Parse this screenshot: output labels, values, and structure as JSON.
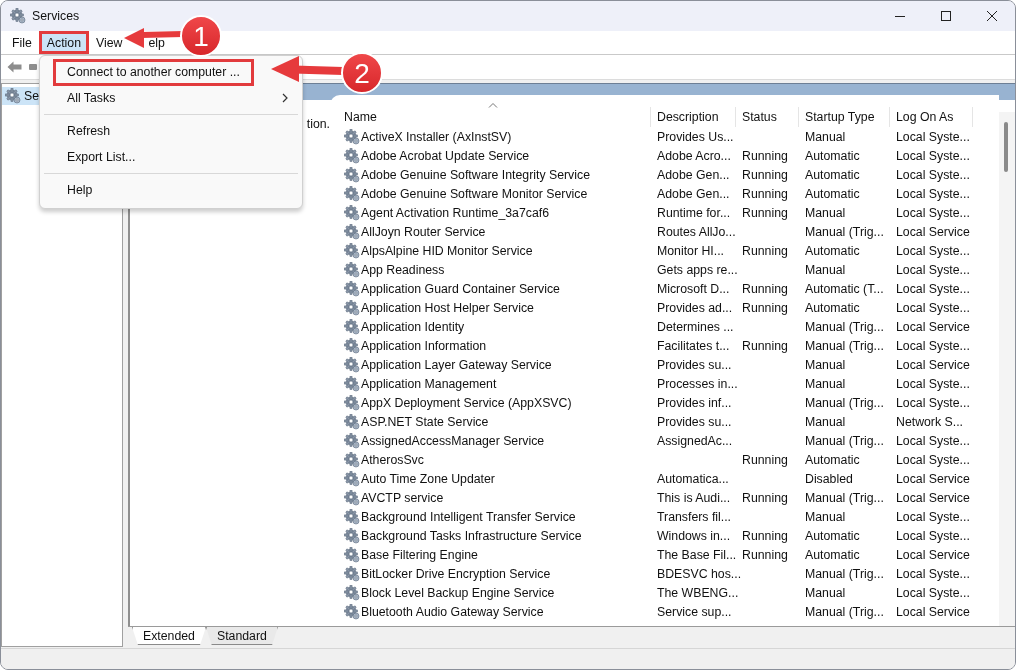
{
  "window": {
    "title": "Services"
  },
  "menu_bar": [
    {
      "label": "File",
      "selected": false,
      "outlined": false
    },
    {
      "label": "Action",
      "selected": true,
      "outlined": true
    },
    {
      "label": "View",
      "selected": false,
      "outlined": false
    },
    {
      "label": "elp",
      "selected": false,
      "outlined": false
    }
  ],
  "action_menu": [
    {
      "kind": "item",
      "label": "Connect to another computer ...",
      "outlined": true
    },
    {
      "kind": "submenu",
      "label": "All Tasks",
      "outlined": false
    },
    {
      "kind": "separator"
    },
    {
      "kind": "item",
      "label": "Refresh",
      "outlined": false
    },
    {
      "kind": "item",
      "label": "Export List...",
      "outlined": false
    },
    {
      "kind": "separator"
    },
    {
      "kind": "item",
      "label": "Help",
      "outlined": false
    }
  ],
  "tree": {
    "items": [
      {
        "label": "Se",
        "selected": true
      }
    ]
  },
  "description_pane": {
    "text": "tion."
  },
  "table": {
    "columns": [
      "Name",
      "Description",
      "Status",
      "Startup Type",
      "Log On As"
    ],
    "rows": [
      {
        "name": "ActiveX Installer (AxInstSV)",
        "description": "Provides Us...",
        "startup_type": "Manual",
        "log_on_as": "Local Syste..."
      },
      {
        "name": "Adobe Acrobat Update Service",
        "description": "Adobe Acro...",
        "status": "Running",
        "startup_type": "Automatic",
        "log_on_as": "Local Syste..."
      },
      {
        "name": "Adobe Genuine Software Integrity Service",
        "description": "Adobe Gen...",
        "status": "Running",
        "startup_type": "Automatic",
        "log_on_as": "Local Syste..."
      },
      {
        "name": "Adobe Genuine Software Monitor Service",
        "description": "Adobe Gen...",
        "status": "Running",
        "startup_type": "Automatic",
        "log_on_as": "Local Syste..."
      },
      {
        "name": "Agent Activation Runtime_3a7caf6",
        "description": "Runtime for...",
        "status": "Running",
        "startup_type": "Manual",
        "log_on_as": "Local Syste..."
      },
      {
        "name": "AllJoyn Router Service",
        "description": "Routes AllJo...",
        "startup_type": "Manual (Trig...",
        "log_on_as": "Local Service"
      },
      {
        "name": "AlpsAlpine HID Monitor Service",
        "description": "Monitor HI...",
        "status": "Running",
        "startup_type": "Automatic",
        "log_on_as": "Local Syste..."
      },
      {
        "name": "App Readiness",
        "description": "Gets apps re...",
        "startup_type": "Manual",
        "log_on_as": "Local Syste..."
      },
      {
        "name": "Application Guard Container Service",
        "description": "Microsoft D...",
        "status": "Running",
        "startup_type": "Automatic (T...",
        "log_on_as": "Local Syste..."
      },
      {
        "name": "Application Host Helper Service",
        "description": "Provides ad...",
        "status": "Running",
        "startup_type": "Automatic",
        "log_on_as": "Local Syste..."
      },
      {
        "name": "Application Identity",
        "description": "Determines ...",
        "startup_type": "Manual (Trig...",
        "log_on_as": "Local Service"
      },
      {
        "name": "Application Information",
        "description": "Facilitates t...",
        "status": "Running",
        "startup_type": "Manual (Trig...",
        "log_on_as": "Local Syste..."
      },
      {
        "name": "Application Layer Gateway Service",
        "description": "Provides su...",
        "startup_type": "Manual",
        "log_on_as": "Local Service"
      },
      {
        "name": "Application Management",
        "description": "Processes in...",
        "startup_type": "Manual",
        "log_on_as": "Local Syste..."
      },
      {
        "name": "AppX Deployment Service (AppXSVC)",
        "description": "Provides inf...",
        "startup_type": "Manual (Trig...",
        "log_on_as": "Local Syste..."
      },
      {
        "name": "ASP.NET State Service",
        "description": "Provides su...",
        "startup_type": "Manual",
        "log_on_as": "Network S..."
      },
      {
        "name": "AssignedAccessManager Service",
        "description": "AssignedAc...",
        "startup_type": "Manual (Trig...",
        "log_on_as": "Local Syste..."
      },
      {
        "name": "AtherosSvc",
        "status": "Running",
        "startup_type": "Automatic",
        "log_on_as": "Local Syste..."
      },
      {
        "name": "Auto Time Zone Updater",
        "description": "Automatica...",
        "startup_type": "Disabled",
        "log_on_as": "Local Service"
      },
      {
        "name": "AVCTP service",
        "description": "This is Audi...",
        "status": "Running",
        "startup_type": "Manual (Trig...",
        "log_on_as": "Local Service"
      },
      {
        "name": "Background Intelligent Transfer Service",
        "description": "Transfers fil...",
        "startup_type": "Manual",
        "log_on_as": "Local Syste..."
      },
      {
        "name": "Background Tasks Infrastructure Service",
        "description": "Windows in...",
        "status": "Running",
        "startup_type": "Automatic",
        "log_on_as": "Local Syste..."
      },
      {
        "name": "Base Filtering Engine",
        "description": "The Base Fil...",
        "status": "Running",
        "startup_type": "Automatic",
        "log_on_as": "Local Service"
      },
      {
        "name": "BitLocker Drive Encryption Service",
        "description": "BDESVC hos...",
        "startup_type": "Manual (Trig...",
        "log_on_as": "Local Syste..."
      },
      {
        "name": "Block Level Backup Engine Service",
        "description": "The WBENG...",
        "startup_type": "Manual",
        "log_on_as": "Local Syste..."
      },
      {
        "name": "Bluetooth Audio Gateway Service",
        "description": "Service sup...",
        "startup_type": "Manual (Trig...",
        "log_on_as": "Local Service"
      }
    ]
  },
  "view_tabs": [
    {
      "label": "Extended",
      "selected": true
    },
    {
      "label": "Standard",
      "selected": false
    }
  ],
  "annotations": [
    {
      "number": "1"
    },
    {
      "number": "2"
    }
  ]
}
